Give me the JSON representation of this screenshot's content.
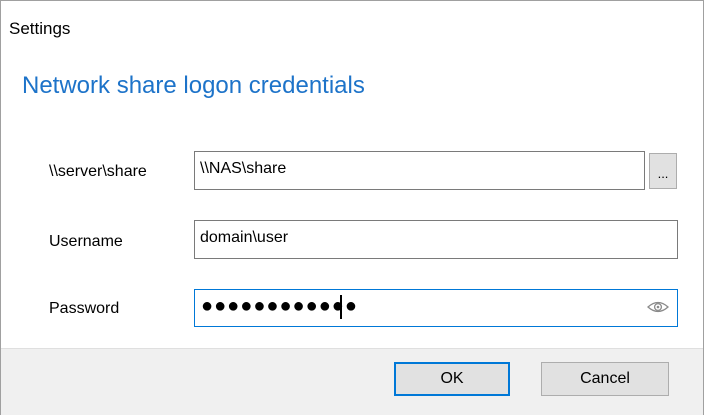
{
  "window": {
    "title": "Settings"
  },
  "heading": "Network share logon credentials",
  "form": {
    "share": {
      "label": "\\\\server\\share",
      "value": "\\\\NAS\\share",
      "browse_label": "..."
    },
    "username": {
      "label": "Username",
      "value": "domain\\user"
    },
    "password": {
      "label": "Password",
      "masked_value": "●●●●●●●●●●●●",
      "reveal_icon": "eye-icon"
    }
  },
  "buttons": {
    "ok": "OK",
    "cancel": "Cancel"
  },
  "colors": {
    "heading": "#1d73c9",
    "focus": "#0078d7",
    "footer_bg": "#f0f0f0"
  }
}
